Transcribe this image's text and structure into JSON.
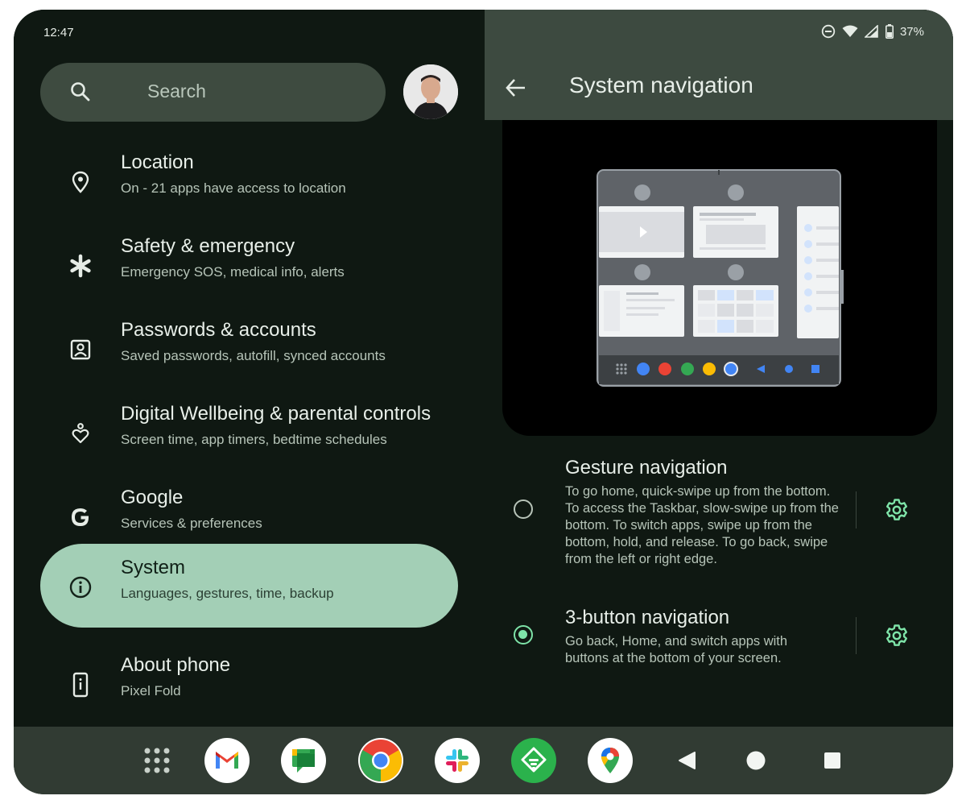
{
  "status": {
    "time": "12:47",
    "battery": "37%"
  },
  "left_panel": {
    "search_placeholder": "Search",
    "items": [
      {
        "title": "Location",
        "subtitle": "On - 21 apps have access to location",
        "icon": "location-pin-icon"
      },
      {
        "title": "Safety & emergency",
        "subtitle": "Emergency SOS, medical info, alerts",
        "icon": "asterisk-icon"
      },
      {
        "title": "Passwords & accounts",
        "subtitle": "Saved passwords, autofill, synced accounts",
        "icon": "account-box-icon"
      },
      {
        "title": "Digital Wellbeing & parental controls",
        "subtitle": "Screen time, app timers, bedtime schedules",
        "icon": "wellbeing-heart-icon"
      },
      {
        "title": "Google",
        "subtitle": "Services & preferences",
        "icon": "google-g-icon"
      },
      {
        "title": "System",
        "subtitle": "Languages, gestures, time, backup",
        "icon": "info-icon",
        "selected": true
      },
      {
        "title": "About phone",
        "subtitle": "Pixel Fold",
        "icon": "phone-info-icon"
      }
    ]
  },
  "right_panel": {
    "title": "System navigation",
    "options": [
      {
        "title": "Gesture navigation",
        "description": "To go home, quick-swipe up from the bottom. To access the Taskbar, slow-swipe up from the bottom. To switch apps, swipe up from the bottom, hold, and release. To go back, swipe from the left or right edge.",
        "selected": false
      },
      {
        "title": "3-button navigation",
        "description": "Go back, Home, and switch apps with buttons at the bottom of your screen.",
        "selected": true
      }
    ]
  },
  "taskbar": {
    "apps": [
      "app-drawer-icon",
      "gmail-icon",
      "google-chat-icon",
      "chrome-icon",
      "slack-icon",
      "feedly-icon",
      "google-maps-icon"
    ],
    "nav_buttons": [
      "back-triangle-icon",
      "home-circle-icon",
      "recents-square-icon"
    ]
  },
  "colors": {
    "background": "#0f1812",
    "header": "#3d4a40",
    "selected_item": "#a3cfb6",
    "accent": "#7ee3a8",
    "taskbar": "#313b33"
  }
}
